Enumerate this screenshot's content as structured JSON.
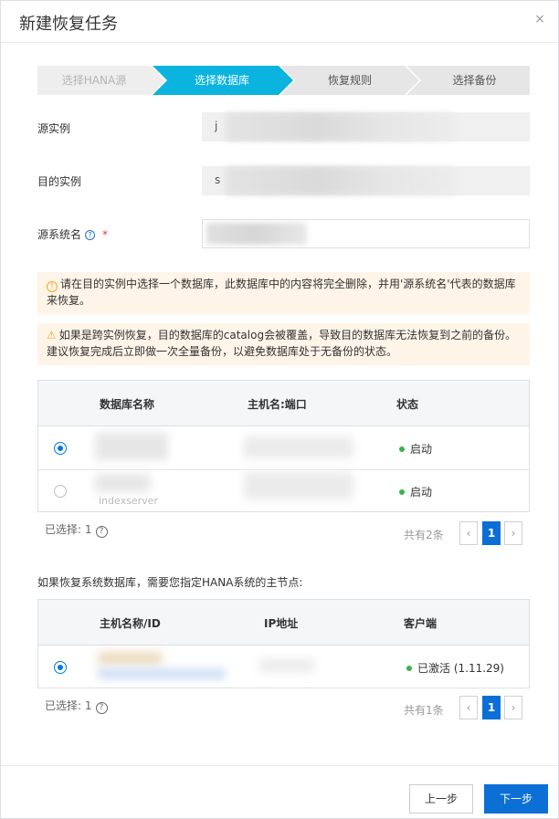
{
  "dialog": {
    "title": "新建恢复任务",
    "close_label": "×"
  },
  "steps": [
    {
      "label": "选择HANA源",
      "state": "done"
    },
    {
      "label": "选择数据库",
      "state": "active"
    },
    {
      "label": "恢复规则",
      "state": "todo"
    },
    {
      "label": "选择备份",
      "state": "todo"
    }
  ],
  "form": {
    "source_instance_label": "源实例",
    "source_instance_visible": "j",
    "target_instance_label": "目的实例",
    "target_instance_visible": "s",
    "source_sid_label": "源系统名",
    "required_mark": "*",
    "help_mark": "?"
  },
  "alerts": [
    {
      "icon": "!",
      "text": "请在目的实例中选择一个数据库，此数据库中的内容将完全删除，并用'源系统名'代表的数据库来恢复。"
    },
    {
      "icon": "⚠",
      "text": "如果是跨实例恢复，目的数据库的catalog会被覆盖，导致目的数据库无法恢复到之前的备份。建议恢复完成后立即做一次全量备份，以避免数据库处于无备份的状态。"
    }
  ],
  "db_table": {
    "columns": [
      "数据库名称",
      "主机名:端口",
      "状态"
    ],
    "rows": [
      {
        "selected": true,
        "status": "启动"
      },
      {
        "selected": false,
        "status": "启动",
        "sub_hint": "indexserver"
      }
    ],
    "selected_text": "已选择: 1",
    "help_mark": "?",
    "total_text": "共有2条",
    "page": "1",
    "prev": "‹",
    "next": "›"
  },
  "hint": "如果恢复系统数据库，需要您指定HANA系统的主节点:",
  "host_table": {
    "columns": [
      "主机名称/ID",
      "IP地址",
      "客户端"
    ],
    "rows": [
      {
        "selected": true,
        "client_status": "已激活 (1.11.29)"
      }
    ],
    "selected_text": "已选择: 1",
    "help_mark": "?",
    "total_text": "共有1条",
    "page": "1",
    "prev": "‹",
    "next": "›"
  },
  "buttons": {
    "prev": "上一步",
    "next": "下一步"
  },
  "colors": {
    "primary": "#0b6fd6",
    "step_active": "#0ab4de",
    "success": "#3db24b",
    "warning": "#f5a623",
    "alert_bg": "#fff4e8"
  }
}
